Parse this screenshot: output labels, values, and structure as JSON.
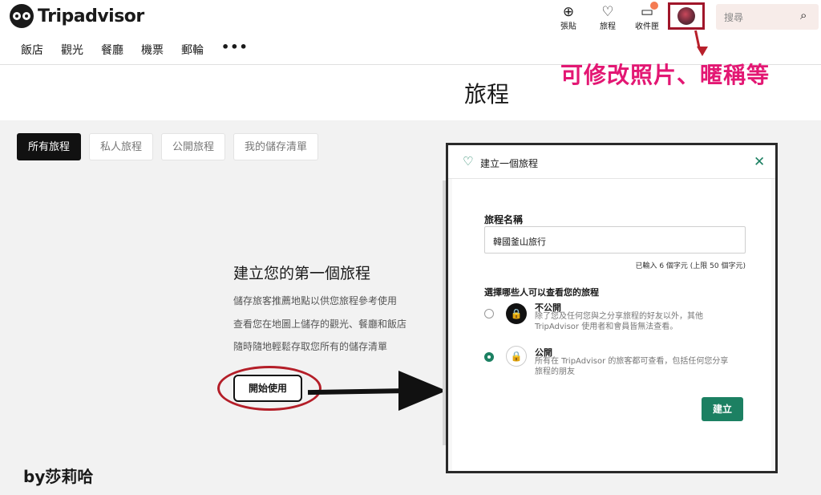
{
  "brand": {
    "name": "Tripadvisor"
  },
  "nav": {
    "items": [
      "飯店",
      "觀光",
      "餐廳",
      "機票",
      "郵輪"
    ],
    "more": "•••"
  },
  "toolbar": {
    "review": {
      "label": "張貼",
      "icon": "plus-circle-icon"
    },
    "trips": {
      "label": "旅程",
      "icon": "heart-icon"
    },
    "inbox": {
      "label": "收件匣",
      "icon": "chat-bubble-icon"
    }
  },
  "search": {
    "placeholder": "搜尋"
  },
  "annotation": {
    "profile_note": "可修改照片、暱稱等",
    "byline": "by莎莉哈"
  },
  "page": {
    "title": "旅程"
  },
  "tabs": [
    "所有旅程",
    "私人旅程",
    "公開旅程",
    "我的儲存清單"
  ],
  "intro": {
    "title": "建立您的第一個旅程",
    "lines": [
      "儲存旅客推薦地點以供您旅程參考使用",
      "查看您在地圖上儲存的觀光、餐廳和飯店",
      "隨時隨地輕鬆存取您所有的儲存清單"
    ],
    "button": "開始使用"
  },
  "modal": {
    "title": "建立一個旅程",
    "name_label": "旅程名稱",
    "name_value": "韓國釜山旅行",
    "char_count": "已輸入 6 個字元 (上限 50 個字元)",
    "visibility_question": "選擇哪些人可以查看您的旅程",
    "options": [
      {
        "title": "不公開",
        "desc": "除了您及任何您與之分享旅程的好友以外，其他 TripAdvisor 使用者和會員皆無法查看。",
        "selected": false
      },
      {
        "title": "公開",
        "desc": "所有在 TripAdvisor 的旅客都可查看，包括任何您分享旅程的朋友",
        "selected": true
      }
    ],
    "create_button": "建立"
  },
  "colors": {
    "accent": "#1c8062",
    "annotation": "#e31773",
    "highlight": "#b41e28"
  }
}
